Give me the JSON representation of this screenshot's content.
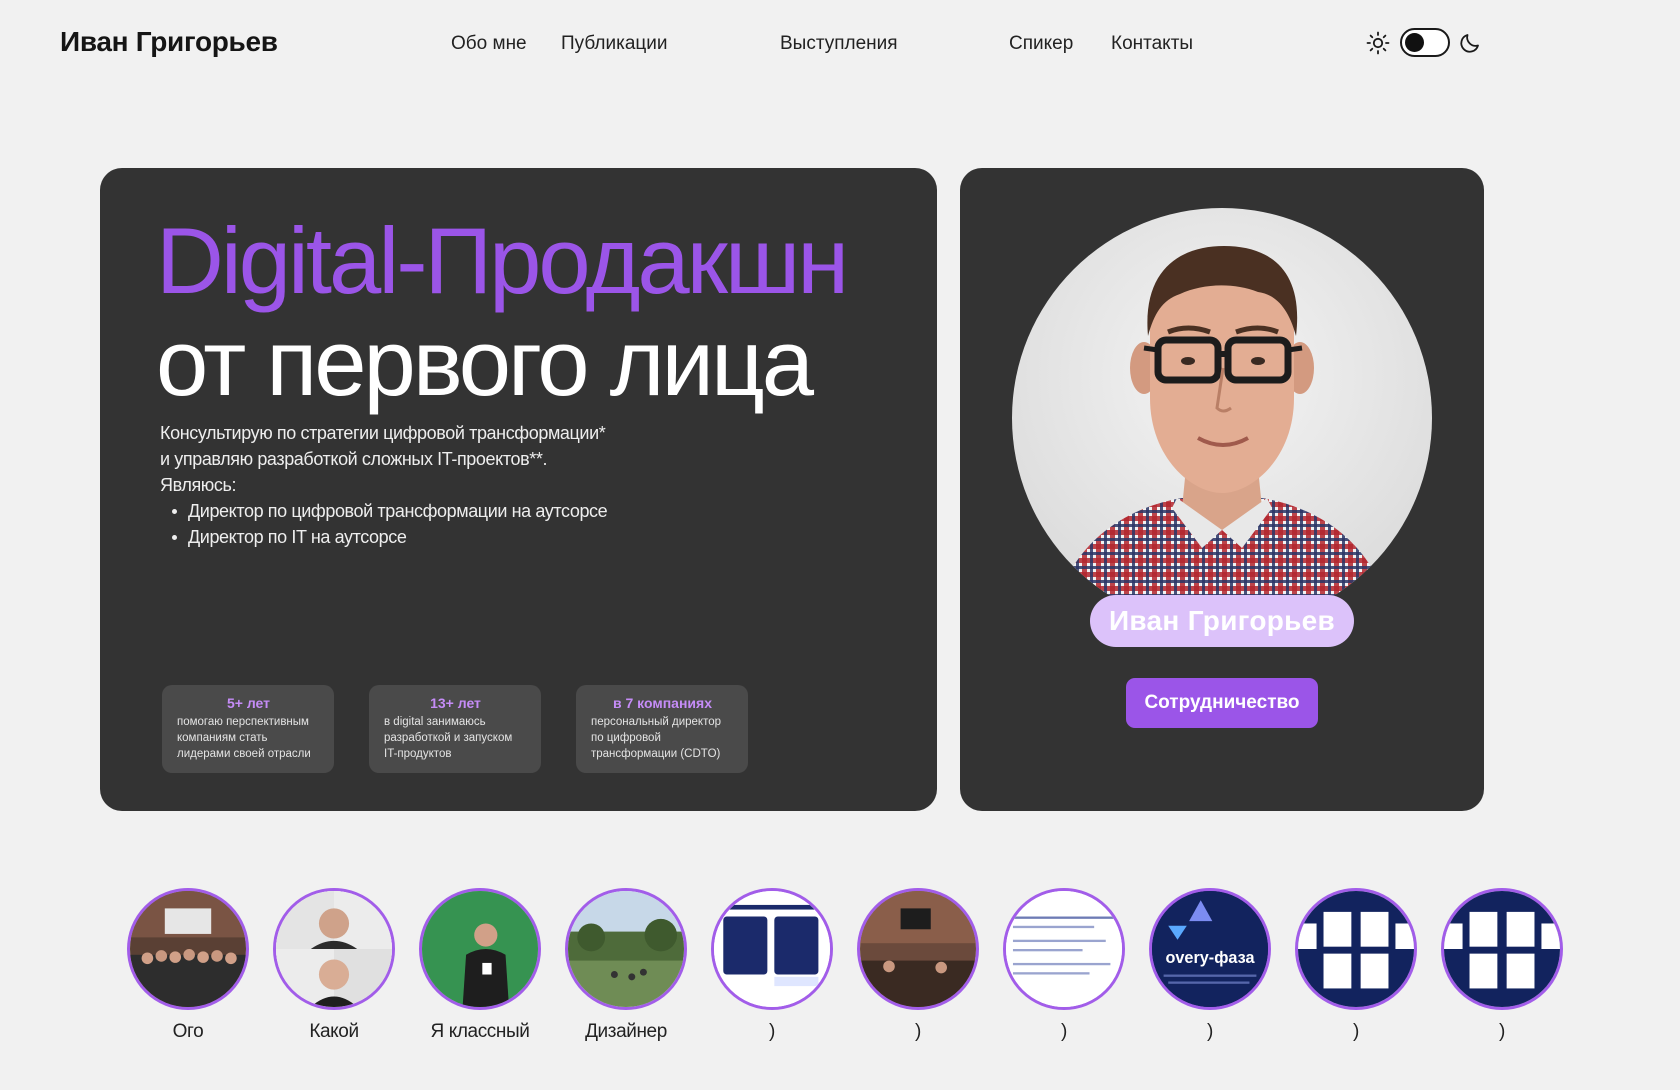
{
  "header": {
    "logo": "Иван Григорьев",
    "nav": [
      {
        "label": "Обо мне"
      },
      {
        "label": "Публикации"
      },
      {
        "label": "Выступления"
      },
      {
        "label": "Спикер"
      },
      {
        "label": "Контакты"
      }
    ],
    "theme": {
      "current": "light",
      "icons": [
        "sun-icon",
        "moon-icon"
      ]
    }
  },
  "hero": {
    "title_line1": "Digital-Продакшн",
    "title_line2": "от первого лица",
    "description_line1": "Консультирую по стратегии цифровой трансформации*",
    "description_line2": "и управляю разработкой сложных IT-проектов**.",
    "description_line3": "Являюсь:",
    "roles": [
      "Директор по цифровой трансформации на аутсорсе",
      "Директор по IT на аутсорсе"
    ],
    "stats": [
      {
        "title": "5+ лет",
        "line1": "помогаю перспективным",
        "line2": "компаниям стать",
        "line3": "лидерами своей отрасли"
      },
      {
        "title": "13+ лет",
        "line1": "в digital занимаюсь",
        "line2": "разработкой и запуском",
        "line3": "IT-продуктов"
      },
      {
        "title": "в 7 компаниях",
        "line1": "персональный директор",
        "line2": "по цифровой",
        "line3": "трансформации (CDTO)"
      }
    ]
  },
  "profile": {
    "name": "Иван Григорьев",
    "button_label": "Сотрудничество"
  },
  "stories": [
    {
      "label": "Ого"
    },
    {
      "label": "Какой"
    },
    {
      "label": "Я классный"
    },
    {
      "label": "Дизайнер"
    },
    {
      "label": ")"
    },
    {
      "label": ")"
    },
    {
      "label": ")"
    },
    {
      "label": ")",
      "thumb_text": "overy-фаза"
    },
    {
      "label": ")"
    },
    {
      "label": ")"
    }
  ],
  "colors": {
    "background": "#f1f1f1",
    "card": "#333333",
    "accent": "#9b55e8",
    "accent_light": "#dcc2fa",
    "stat_card": "#4a4a4a"
  }
}
